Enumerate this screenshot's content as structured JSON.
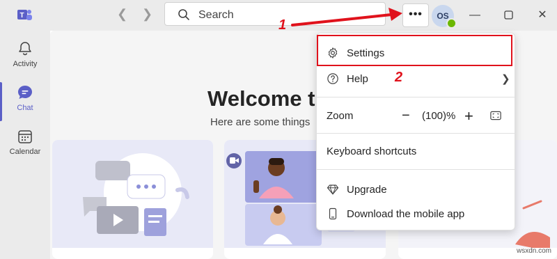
{
  "app": {
    "logo": "teams-logo-icon"
  },
  "search": {
    "placeholder": "Search"
  },
  "header": {
    "more_label": "•••",
    "avatar_initials": "OS"
  },
  "rail": {
    "items": [
      {
        "label": "Activity",
        "icon": "bell-icon",
        "active": false
      },
      {
        "label": "Chat",
        "icon": "chat-icon",
        "active": true
      },
      {
        "label": "Calendar",
        "icon": "calendar-icon",
        "active": false
      }
    ]
  },
  "main": {
    "welcome": "Welcome t",
    "subtitle": "Here are some things"
  },
  "menu": {
    "settings": "Settings",
    "help": "Help",
    "zoom_label": "Zoom",
    "zoom_out": "−",
    "zoom_value": "(100)%",
    "zoom_in": "+",
    "keyboard_shortcuts": "Keyboard shortcuts",
    "upgrade": "Upgrade",
    "download_mobile": "Download the mobile app"
  },
  "annotations": {
    "step1": "1",
    "step2": "2"
  },
  "colors": {
    "accent": "#5b5fc7",
    "annotation": "#e0121c",
    "presence": "#6bb700"
  },
  "watermark": "wsxdn.com"
}
